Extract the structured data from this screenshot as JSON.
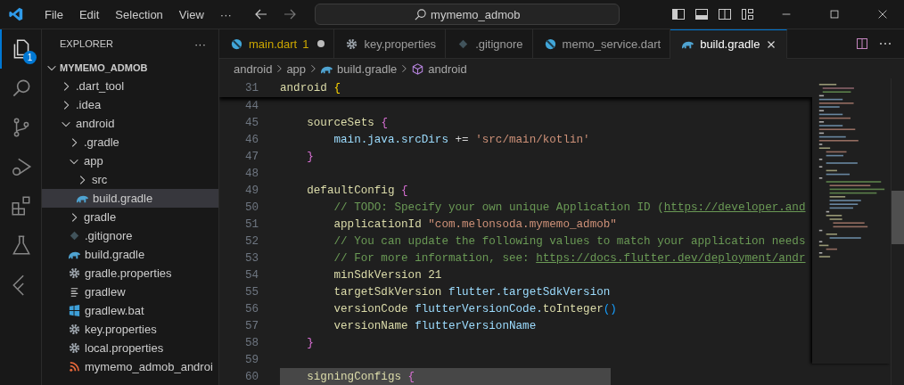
{
  "menu": [
    "File",
    "Edit",
    "Selection",
    "View",
    "···"
  ],
  "command_center": {
    "value": "mymemo_admob"
  },
  "activity_bar": {
    "items": [
      {
        "kind": "explorer",
        "selected": true,
        "badge": "1"
      },
      {
        "kind": "search",
        "selected": false
      },
      {
        "kind": "source-control",
        "selected": false
      },
      {
        "kind": "run-debug",
        "selected": false
      },
      {
        "kind": "extensions",
        "selected": false
      },
      {
        "kind": "testing",
        "selected": false
      },
      {
        "kind": "flutter",
        "selected": false
      }
    ]
  },
  "explorer": {
    "title": "EXPLORER",
    "more": "···",
    "section": {
      "label": "MYMEMO_ADMOB",
      "expanded": true
    },
    "tree": [
      {
        "label": ".dart_tool",
        "kind": "folder",
        "expanded": false,
        "selected": false
      },
      {
        "label": ".idea",
        "kind": "folder",
        "expanded": false,
        "selected": false
      },
      {
        "label": "android",
        "kind": "folder",
        "expanded": true,
        "selected": false,
        "children": [
          {
            "label": ".gradle",
            "kind": "folder",
            "expanded": false,
            "selected": false
          },
          {
            "label": "app",
            "kind": "folder",
            "expanded": true,
            "selected": false,
            "children": [
              {
                "label": "src",
                "kind": "folder",
                "expanded": false,
                "selected": false
              },
              {
                "label": "build.gradle",
                "kind": "gradle",
                "selected": true
              }
            ]
          },
          {
            "label": "gradle",
            "kind": "folder",
            "expanded": false,
            "selected": false
          },
          {
            "label": ".gitignore",
            "kind": "git",
            "selected": false
          },
          {
            "label": "build.gradle",
            "kind": "gradle",
            "selected": false
          },
          {
            "label": "gradle.properties",
            "kind": "settings",
            "selected": false
          },
          {
            "label": "gradlew",
            "kind": "text",
            "selected": false
          },
          {
            "label": "gradlew.bat",
            "kind": "windows",
            "selected": false
          },
          {
            "label": "key.properties",
            "kind": "settings",
            "selected": false
          },
          {
            "label": "local.properties",
            "kind": "settings",
            "selected": false
          },
          {
            "label": "mymemo_admob_androi",
            "kind": "feed",
            "selected": false
          }
        ]
      }
    ]
  },
  "tabs": [
    {
      "label": "main.dart",
      "badge": "1",
      "kind": "dart",
      "modified": true,
      "selected": false
    },
    {
      "label": "key.properties",
      "kind": "settings",
      "modified": false,
      "selected": false
    },
    {
      "label": ".gitignore",
      "kind": "git",
      "modified": false,
      "selected": false
    },
    {
      "label": "memo_service.dart",
      "kind": "dart",
      "modified": false,
      "selected": false
    },
    {
      "label": "build.gradle",
      "kind": "gradle",
      "modified": false,
      "selected": true
    }
  ],
  "breadcrumb": [
    {
      "label": "android",
      "kind": "folder"
    },
    {
      "label": "app",
      "kind": "folder"
    },
    {
      "label": "build.gradle",
      "kind": "gradle"
    },
    {
      "label": "android",
      "kind": "symbol"
    }
  ],
  "code": {
    "lines": [
      {
        "number": "31",
        "sticky": true,
        "highlighted": false,
        "tokens": [
          {
            "text": "android ",
            "kind": "fn"
          },
          {
            "text": "{",
            "kind": "brace1"
          }
        ]
      },
      {
        "number": "44",
        "sticky": false,
        "highlighted": false
      },
      {
        "number": "45",
        "sticky": false,
        "highlighted": false,
        "tokens": [
          {
            "text": "    sourceSets ",
            "kind": "fn"
          },
          {
            "text": "{",
            "kind": "brace2"
          }
        ]
      },
      {
        "number": "46",
        "sticky": false,
        "highlighted": false,
        "tokens": [
          {
            "text": "        main.java.srcDirs",
            "kind": "var"
          },
          {
            "text": " += ",
            "kind": "plain"
          },
          {
            "text": "'src/main/kotlin'",
            "kind": "string"
          }
        ]
      },
      {
        "number": "47",
        "sticky": false,
        "highlighted": false,
        "tokens": [
          {
            "text": "    }",
            "kind": "brace2"
          }
        ]
      },
      {
        "number": "48",
        "sticky": false,
        "highlighted": false
      },
      {
        "number": "49",
        "sticky": false,
        "highlighted": false,
        "tokens": [
          {
            "text": "    defaultConfig ",
            "kind": "fn"
          },
          {
            "text": "{",
            "kind": "brace2"
          }
        ]
      },
      {
        "number": "50",
        "sticky": false,
        "highlighted": false,
        "tokens": [
          {
            "text": "        // TODO: Specify your own unique Application ID (",
            "kind": "comment"
          },
          {
            "text": "https://developer.and",
            "kind": "link"
          }
        ]
      },
      {
        "number": "51",
        "sticky": false,
        "highlighted": false,
        "tokens": [
          {
            "text": "        applicationId ",
            "kind": "fn"
          },
          {
            "text": "\"com.melonsoda.mymemo_admob\"",
            "kind": "string"
          }
        ]
      },
      {
        "number": "52",
        "sticky": false,
        "highlighted": false,
        "tokens": [
          {
            "text": "        // You can update the following values to match your application needs",
            "kind": "comment"
          }
        ]
      },
      {
        "number": "53",
        "sticky": false,
        "highlighted": false,
        "tokens": [
          {
            "text": "        // For more information, see: ",
            "kind": "comment"
          },
          {
            "text": "https://docs.flutter.dev/deployment/andr",
            "kind": "link"
          }
        ]
      },
      {
        "number": "54",
        "sticky": false,
        "highlighted": false,
        "tokens": [
          {
            "text": "        minSdkVersion 21",
            "kind": "fn"
          }
        ]
      },
      {
        "number": "55",
        "sticky": false,
        "highlighted": false,
        "tokens": [
          {
            "text": "        targetSdkVersion ",
            "kind": "fn"
          },
          {
            "text": "flutter.targetSdkVersion",
            "kind": "var"
          }
        ]
      },
      {
        "number": "56",
        "sticky": false,
        "highlighted": false,
        "tokens": [
          {
            "text": "        versionCode ",
            "kind": "fn"
          },
          {
            "text": "flutterVersionCode.",
            "kind": "var"
          },
          {
            "text": "toInteger",
            "kind": "fn"
          },
          {
            "text": "()",
            "kind": "brace3"
          }
        ]
      },
      {
        "number": "57",
        "sticky": false,
        "highlighted": false,
        "tokens": [
          {
            "text": "        versionName ",
            "kind": "fn"
          },
          {
            "text": "flutterVersionName",
            "kind": "var"
          }
        ]
      },
      {
        "number": "58",
        "sticky": false,
        "highlighted": false,
        "tokens": [
          {
            "text": "    }",
            "kind": "brace2"
          }
        ]
      },
      {
        "number": "59",
        "sticky": false,
        "highlighted": false
      },
      {
        "number": "60",
        "sticky": false,
        "highlighted": true,
        "tokens": [
          {
            "text": "    signingConfigs ",
            "kind": "fn"
          },
          {
            "text": "{",
            "kind": "brace2"
          }
        ]
      }
    ]
  }
}
